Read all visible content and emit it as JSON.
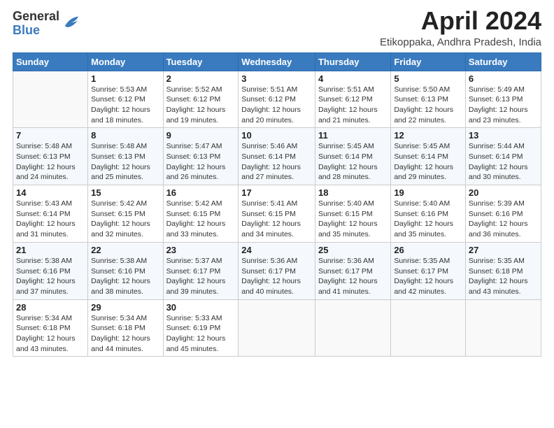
{
  "header": {
    "logo_general": "General",
    "logo_blue": "Blue",
    "month_title": "April 2024",
    "location": "Etikoppaka, Andhra Pradesh, India"
  },
  "calendar": {
    "days_of_week": [
      "Sunday",
      "Monday",
      "Tuesday",
      "Wednesday",
      "Thursday",
      "Friday",
      "Saturday"
    ],
    "weeks": [
      [
        {
          "day": "",
          "info": ""
        },
        {
          "day": "1",
          "info": "Sunrise: 5:53 AM\nSunset: 6:12 PM\nDaylight: 12 hours\nand 18 minutes."
        },
        {
          "day": "2",
          "info": "Sunrise: 5:52 AM\nSunset: 6:12 PM\nDaylight: 12 hours\nand 19 minutes."
        },
        {
          "day": "3",
          "info": "Sunrise: 5:51 AM\nSunset: 6:12 PM\nDaylight: 12 hours\nand 20 minutes."
        },
        {
          "day": "4",
          "info": "Sunrise: 5:51 AM\nSunset: 6:12 PM\nDaylight: 12 hours\nand 21 minutes."
        },
        {
          "day": "5",
          "info": "Sunrise: 5:50 AM\nSunset: 6:13 PM\nDaylight: 12 hours\nand 22 minutes."
        },
        {
          "day": "6",
          "info": "Sunrise: 5:49 AM\nSunset: 6:13 PM\nDaylight: 12 hours\nand 23 minutes."
        }
      ],
      [
        {
          "day": "7",
          "info": "Sunrise: 5:48 AM\nSunset: 6:13 PM\nDaylight: 12 hours\nand 24 minutes."
        },
        {
          "day": "8",
          "info": "Sunrise: 5:48 AM\nSunset: 6:13 PM\nDaylight: 12 hours\nand 25 minutes."
        },
        {
          "day": "9",
          "info": "Sunrise: 5:47 AM\nSunset: 6:13 PM\nDaylight: 12 hours\nand 26 minutes."
        },
        {
          "day": "10",
          "info": "Sunrise: 5:46 AM\nSunset: 6:14 PM\nDaylight: 12 hours\nand 27 minutes."
        },
        {
          "day": "11",
          "info": "Sunrise: 5:45 AM\nSunset: 6:14 PM\nDaylight: 12 hours\nand 28 minutes."
        },
        {
          "day": "12",
          "info": "Sunrise: 5:45 AM\nSunset: 6:14 PM\nDaylight: 12 hours\nand 29 minutes."
        },
        {
          "day": "13",
          "info": "Sunrise: 5:44 AM\nSunset: 6:14 PM\nDaylight: 12 hours\nand 30 minutes."
        }
      ],
      [
        {
          "day": "14",
          "info": "Sunrise: 5:43 AM\nSunset: 6:14 PM\nDaylight: 12 hours\nand 31 minutes."
        },
        {
          "day": "15",
          "info": "Sunrise: 5:42 AM\nSunset: 6:15 PM\nDaylight: 12 hours\nand 32 minutes."
        },
        {
          "day": "16",
          "info": "Sunrise: 5:42 AM\nSunset: 6:15 PM\nDaylight: 12 hours\nand 33 minutes."
        },
        {
          "day": "17",
          "info": "Sunrise: 5:41 AM\nSunset: 6:15 PM\nDaylight: 12 hours\nand 34 minutes."
        },
        {
          "day": "18",
          "info": "Sunrise: 5:40 AM\nSunset: 6:15 PM\nDaylight: 12 hours\nand 35 minutes."
        },
        {
          "day": "19",
          "info": "Sunrise: 5:40 AM\nSunset: 6:16 PM\nDaylight: 12 hours\nand 35 minutes."
        },
        {
          "day": "20",
          "info": "Sunrise: 5:39 AM\nSunset: 6:16 PM\nDaylight: 12 hours\nand 36 minutes."
        }
      ],
      [
        {
          "day": "21",
          "info": "Sunrise: 5:38 AM\nSunset: 6:16 PM\nDaylight: 12 hours\nand 37 minutes."
        },
        {
          "day": "22",
          "info": "Sunrise: 5:38 AM\nSunset: 6:16 PM\nDaylight: 12 hours\nand 38 minutes."
        },
        {
          "day": "23",
          "info": "Sunrise: 5:37 AM\nSunset: 6:17 PM\nDaylight: 12 hours\nand 39 minutes."
        },
        {
          "day": "24",
          "info": "Sunrise: 5:36 AM\nSunset: 6:17 PM\nDaylight: 12 hours\nand 40 minutes."
        },
        {
          "day": "25",
          "info": "Sunrise: 5:36 AM\nSunset: 6:17 PM\nDaylight: 12 hours\nand 41 minutes."
        },
        {
          "day": "26",
          "info": "Sunrise: 5:35 AM\nSunset: 6:17 PM\nDaylight: 12 hours\nand 42 minutes."
        },
        {
          "day": "27",
          "info": "Sunrise: 5:35 AM\nSunset: 6:18 PM\nDaylight: 12 hours\nand 43 minutes."
        }
      ],
      [
        {
          "day": "28",
          "info": "Sunrise: 5:34 AM\nSunset: 6:18 PM\nDaylight: 12 hours\nand 43 minutes."
        },
        {
          "day": "29",
          "info": "Sunrise: 5:34 AM\nSunset: 6:18 PM\nDaylight: 12 hours\nand 44 minutes."
        },
        {
          "day": "30",
          "info": "Sunrise: 5:33 AM\nSunset: 6:19 PM\nDaylight: 12 hours\nand 45 minutes."
        },
        {
          "day": "",
          "info": ""
        },
        {
          "day": "",
          "info": ""
        },
        {
          "day": "",
          "info": ""
        },
        {
          "day": "",
          "info": ""
        }
      ]
    ]
  }
}
